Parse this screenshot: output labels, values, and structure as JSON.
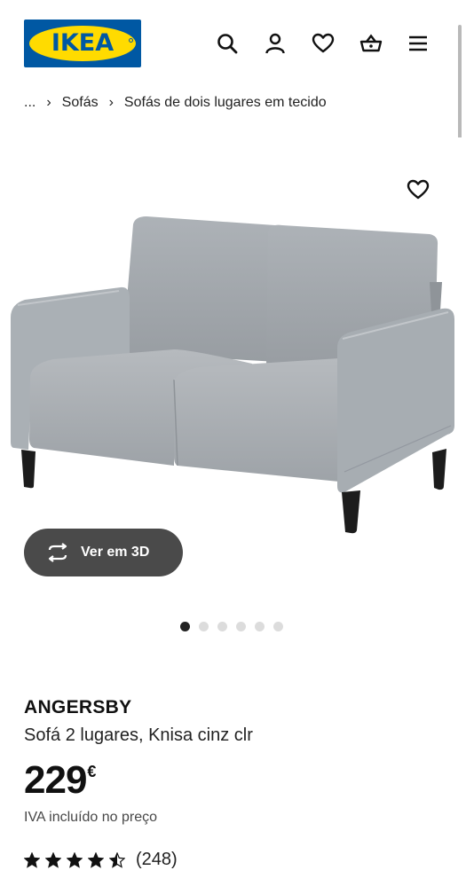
{
  "header": {
    "logo_text": "IKEA",
    "icons": [
      "search-icon",
      "user-icon",
      "heart-icon",
      "basket-icon",
      "menu-icon"
    ]
  },
  "breadcrumb": {
    "ellipsis": "...",
    "separator": "›",
    "items": [
      "Sofás",
      "Sofás de dois lugares em tecido"
    ]
  },
  "gallery": {
    "view_3d_label": "Ver em 3D",
    "dots_total": 6,
    "active_dot": 1
  },
  "product": {
    "name": "ANGERSBY",
    "description": "Sofá 2 lugares, Knisa cinz clr",
    "price_integer": "229",
    "price_currency": "€",
    "vat_note": "IVA incluído no preço",
    "rating_value": 4.5,
    "rating_max": 5,
    "rating_count": "(248)"
  },
  "colors": {
    "ikea_blue": "#0058a3",
    "ikea_yellow": "#ffdb00",
    "sofa_gray": "#a9aeb3",
    "button_dark": "#4a4a4a"
  }
}
